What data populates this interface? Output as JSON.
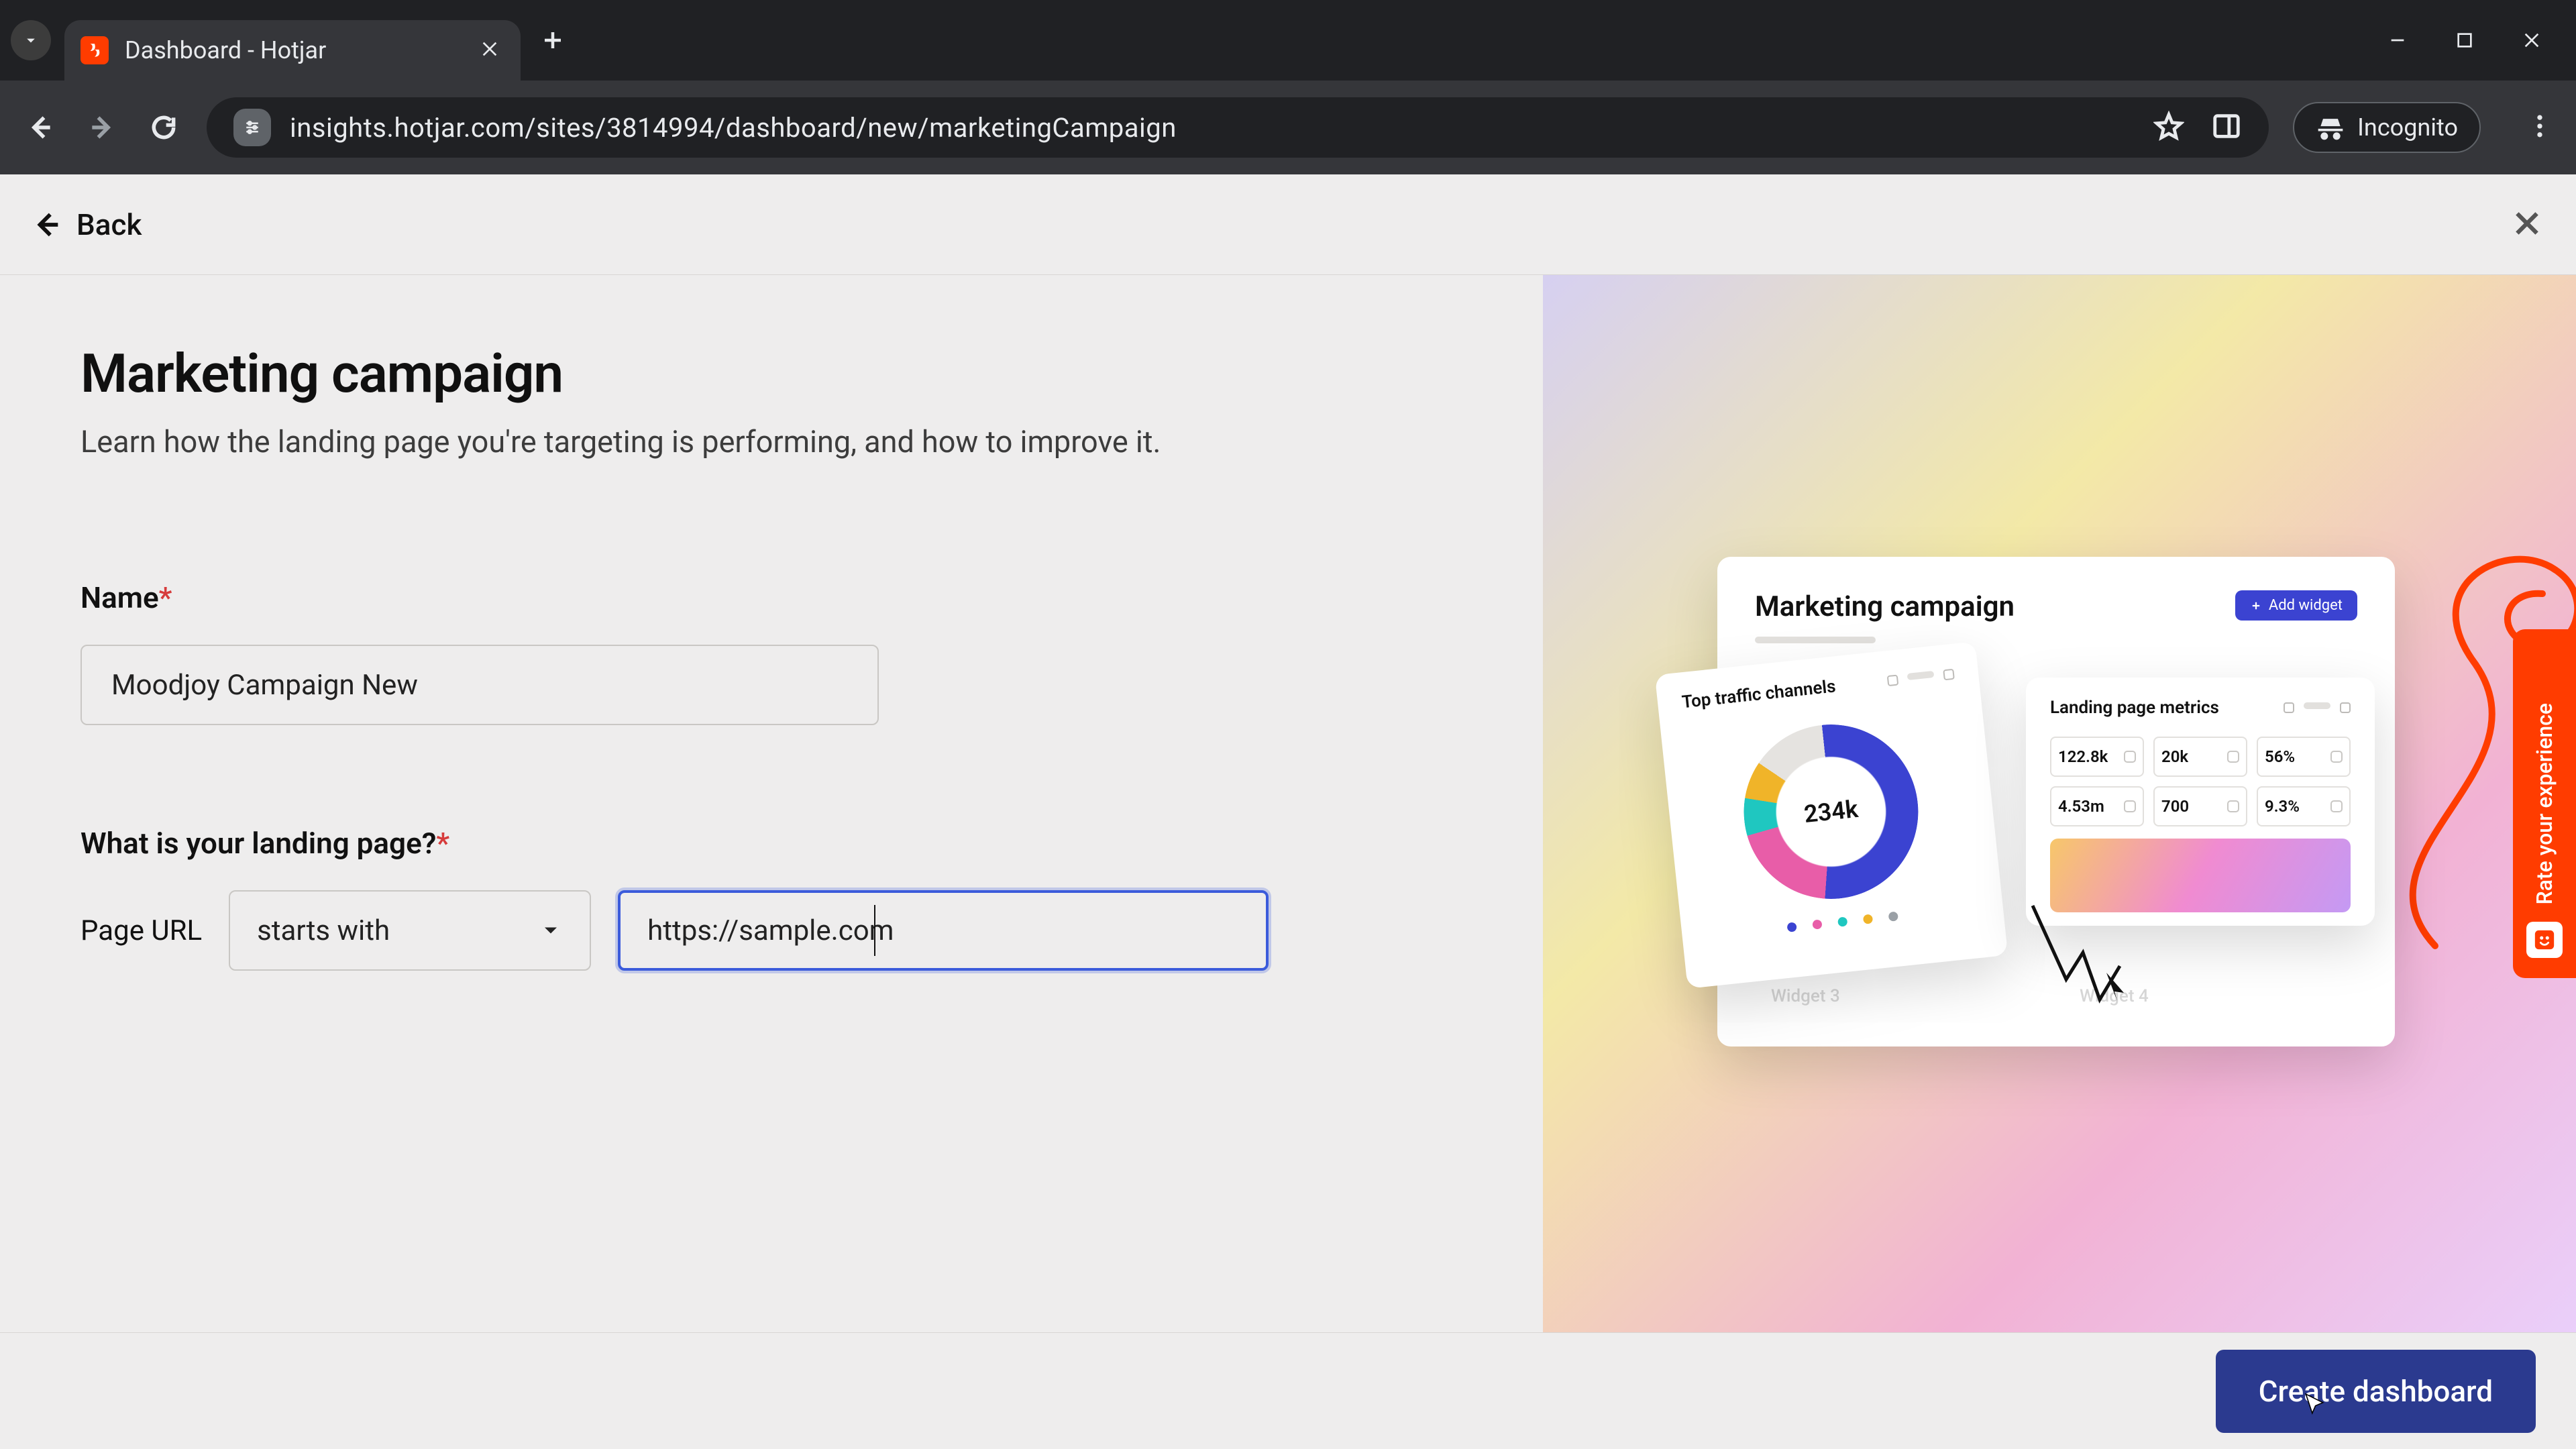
{
  "browser": {
    "tab_title": "Dashboard - Hotjar",
    "url": "insights.hotjar.com/sites/3814994/dashboard/new/marketingCampaign",
    "incognito_label": "Incognito"
  },
  "header": {
    "back_label": "Back"
  },
  "page": {
    "title": "Marketing campaign",
    "subtitle": "Learn how the landing page you're targeting is performing, and how to improve it."
  },
  "form": {
    "name_label": "Name",
    "name_value": "Moodjoy Campaign New",
    "landing_label": "What is your landing page?",
    "page_url_label": "Page URL",
    "match_type_value": "starts with",
    "url_value": "https://sample.com"
  },
  "preview": {
    "card_title": "Marketing campaign",
    "add_widget_label": "Add widget",
    "traffic_title": "Top traffic channels",
    "traffic_center": "234k",
    "legend_colors": [
      "#3b43d1",
      "#e85da8",
      "#1fc7c0",
      "#f0b429",
      "#9aa0a6"
    ],
    "metrics_title": "Landing page metrics",
    "metrics": [
      "122.8k",
      "20k",
      "56%",
      "4.53m",
      "700",
      "9.3%"
    ],
    "ghost_labels": [
      "Widget 3",
      "Widget 4"
    ]
  },
  "footer": {
    "create_label": "Create dashboard"
  },
  "feedback": {
    "label": "Rate your experience"
  }
}
